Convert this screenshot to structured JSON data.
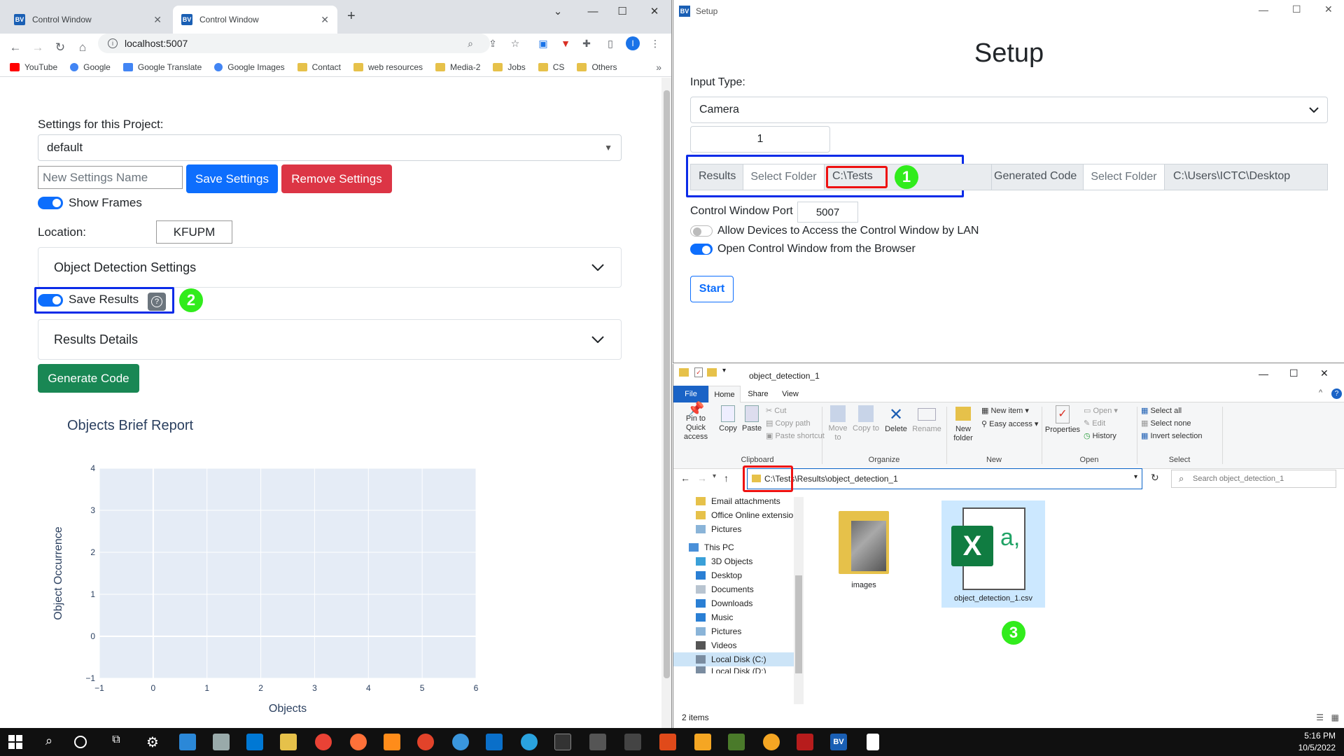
{
  "browser": {
    "tabs": [
      {
        "label": "Control Window",
        "close": "✕"
      },
      {
        "label": "Control Window",
        "close": "✕"
      }
    ],
    "new_tab": "+",
    "url": "localhost:5007",
    "bookmarks": [
      {
        "label": "YouTube",
        "icon": "youtube-icon"
      },
      {
        "label": "Google",
        "icon": "google-icon"
      },
      {
        "label": "Google Translate",
        "icon": "translate-icon"
      },
      {
        "label": "Google Images",
        "icon": "google-icon"
      },
      {
        "label": "Contact",
        "icon": "folder-icon"
      },
      {
        "label": "web resources",
        "icon": "folder-icon"
      },
      {
        "label": "Media-2",
        "icon": "folder-icon"
      },
      {
        "label": "Jobs",
        "icon": "folder-icon"
      },
      {
        "label": "CS",
        "icon": "folder-icon"
      },
      {
        "label": "Others",
        "icon": "folder-icon"
      }
    ],
    "bookmarks_more": "»",
    "profile_initial": "I"
  },
  "control": {
    "settings_label": "Settings for this Project:",
    "settings_value": "default",
    "new_settings_placeholder": "New Settings Name",
    "save_settings": "Save Settings",
    "remove_settings": "Remove Settings",
    "show_frames": "Show Frames",
    "show_frames_on": true,
    "location_label": "Location:",
    "location_value": "KFUPM",
    "object_detection_settings": "Object Detection Settings",
    "save_results": "Save Results",
    "save_results_on": true,
    "help": "?",
    "results_details": "Results Details",
    "generate_code": "Generate Code",
    "annotation_2": "2"
  },
  "chart_data": {
    "type": "bar",
    "title": "Objects Brief Report",
    "xlabel": "Objects",
    "ylabel": "Object Occurrence",
    "categories": [],
    "values": [],
    "xlim": [
      -1,
      6
    ],
    "ylim": [
      -1,
      4
    ],
    "xticks": [
      "−1",
      "0",
      "1",
      "2",
      "3",
      "4",
      "5",
      "6"
    ],
    "yticks": [
      "−1",
      "0",
      "1",
      "2",
      "3",
      "4"
    ],
    "grid": true,
    "plot_bg": "#e5ecf6"
  },
  "setup": {
    "window_title": "Setup",
    "app_icon": "BV",
    "heading": "Setup",
    "input_type_label": "Input Type:",
    "input_type_value": "Camera",
    "camera_index": "1",
    "results_label": "Results",
    "select_folder": "Select Folder",
    "results_path": "C:\\Tests",
    "generated_code_label": "Generated Code",
    "generated_select_folder": "Select Folder",
    "generated_path": "C:\\Users\\ICTC\\Desktop",
    "port_label": "Control Window Port",
    "port_value": "5007",
    "allow_lan": "Allow Devices to Access the Control Window by LAN",
    "allow_lan_on": false,
    "open_browser": "Open Control Window from the Browser",
    "open_browser_on": true,
    "start": "Start",
    "annotation_1": "1"
  },
  "explorer": {
    "title": "object_detection_1",
    "tabs": [
      "File",
      "Home",
      "Share",
      "View"
    ],
    "clipboard": {
      "pin": "Pin to Quick access",
      "copy": "Copy",
      "paste": "Paste",
      "cut": "Cut",
      "copy_path": "Copy path",
      "paste_shortcut": "Paste shortcut",
      "label": "Clipboard"
    },
    "organize": {
      "move": "Move to",
      "copyto": "Copy to",
      "delete": "Delete",
      "rename": "Rename",
      "label": "Organize"
    },
    "new": {
      "new_item": "New item",
      "easy_access": "Easy access",
      "new_folder": "New folder",
      "label": "New"
    },
    "open": {
      "properties": "Properties",
      "open": "Open",
      "edit": "Edit",
      "history": "History",
      "label": "Open"
    },
    "select": {
      "select_all": "Select all",
      "select_none": "Select none",
      "invert": "Invert selection",
      "label": "Select"
    },
    "address": "C:\\Tests\\Results\\object_detection_1",
    "search_placeholder": "Search object_detection_1",
    "nav": [
      {
        "label": "Email attachments",
        "icon": "folder-icon"
      },
      {
        "label": "Office Online extension",
        "icon": "folder-icon"
      },
      {
        "label": "Pictures",
        "icon": "pictures-icon"
      },
      {
        "label": "This PC",
        "icon": "pc-icon"
      },
      {
        "label": "3D Objects",
        "icon": "3d-icon"
      },
      {
        "label": "Desktop",
        "icon": "desktop-icon"
      },
      {
        "label": "Documents",
        "icon": "documents-icon"
      },
      {
        "label": "Downloads",
        "icon": "downloads-icon"
      },
      {
        "label": "Music",
        "icon": "music-icon"
      },
      {
        "label": "Pictures",
        "icon": "pictures-icon"
      },
      {
        "label": "Videos",
        "icon": "videos-icon"
      },
      {
        "label": "Local Disk (C:)",
        "icon": "disk-icon"
      },
      {
        "label": "Local Disk (D:)",
        "icon": "disk-icon"
      }
    ],
    "files": [
      {
        "label": "images",
        "icon": "folder-icon"
      },
      {
        "label": "object_detection_1.csv",
        "icon": "excel-icon"
      }
    ],
    "status": "2 items",
    "annotation_3": "3"
  },
  "taskbar": {
    "time": "5:16 PM",
    "date": "10/5/2022"
  },
  "colors": {
    "primary": "#0d6efd",
    "danger": "#dc3545",
    "success": "#198754",
    "annotation_blue": "#0a2be8",
    "annotation_red": "#e11111",
    "annotation_green": "#31ec1c"
  }
}
